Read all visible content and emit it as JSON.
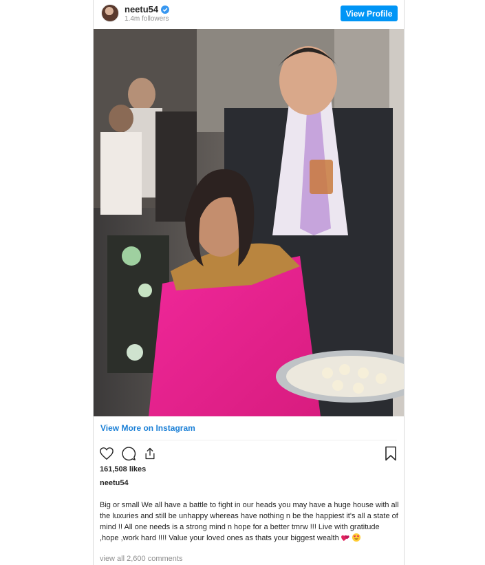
{
  "post": {
    "username": "neetu54",
    "followers": "1.4m followers",
    "view_profile_label": "View Profile",
    "view_more_label": "View More on Instagram",
    "likes": "161,508 likes",
    "caption_username": "neetu54",
    "caption": "Big or small We all have a battle to fight in our heads you may have a huge house with all the luxuries and still be unhappy whereas have nothing n be the happiest it's all a state of mind !! All one needs is a strong mind n hope for a better tmrw !!! Live with gratitude ,hope ,work hard !!!! Value your loved ones as thats your biggest wealth",
    "view_comments": "view all 2,600 comments"
  },
  "colors": {
    "accent": "#0095f6",
    "link": "#1a7fd6",
    "verified": "#3897f0"
  },
  "icons": [
    "heart-icon",
    "comment-icon",
    "share-icon",
    "bookmark-icon",
    "verified-badge-icon"
  ]
}
